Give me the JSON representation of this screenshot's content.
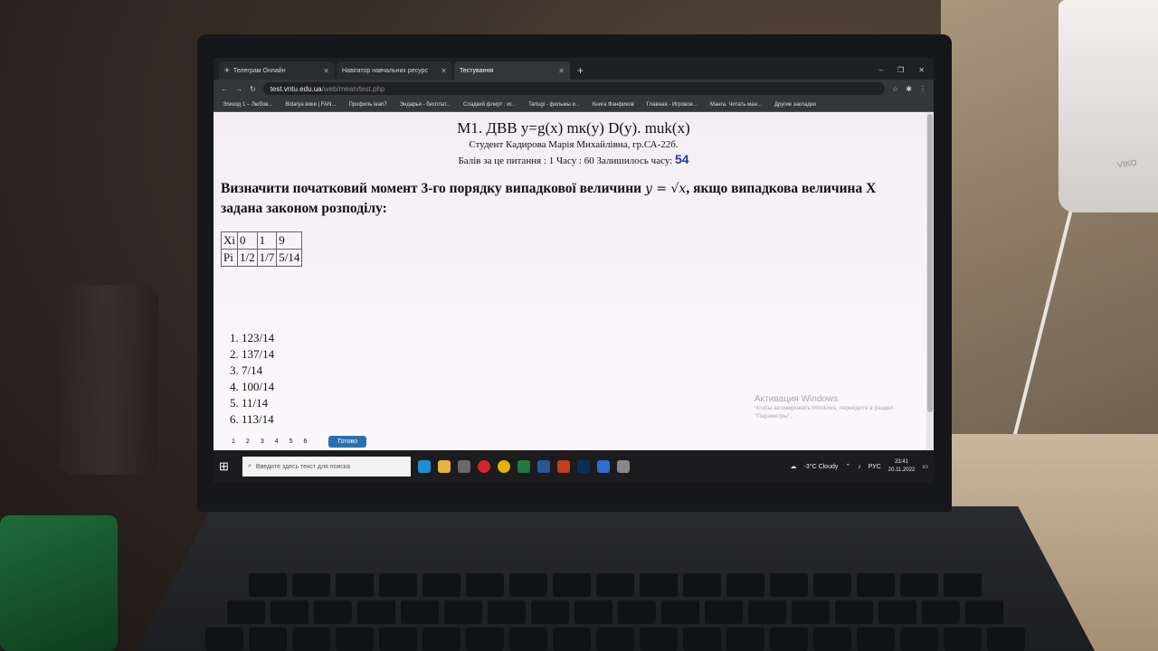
{
  "browser": {
    "tabs": [
      {
        "label": "Телеграм Онлайн"
      },
      {
        "label": "Навігатор навчальних ресурс"
      },
      {
        "label": "Тестування"
      }
    ],
    "url_host": "test.vntu.edu.ua",
    "url_path": "/web/mean/test.php",
    "bookmarks": [
      "Эпизод 1 – Любов...",
      "Bidarya вики | FAN...",
      "Профиль lean7",
      "Эндарья - бесплат...",
      "Сладкий флирт : иг...",
      "Tartugi - фильмы и...",
      "Книга Фанфиков",
      "Главная - Игровое...",
      "Манга. Читать ман...",
      "Другие закладки"
    ]
  },
  "test": {
    "title": "М1. ДВВ y=g(x) mк(y) D(y). muk(x)",
    "student": "Студент Кадирова Марія Михайлівна, гр.СА-22б.",
    "score_info": "Балів за це питання : 1 Часу : 60 Залишилось часу:",
    "time_left": "54",
    "question_pre": "Визначити початковий момент 3-го порядку випадкової величини",
    "question_formula": "y = √x",
    "question_post": ", якщо випадкова величина X задана законом розподілу:",
    "table": {
      "row_x_label": "Xi",
      "row_p_label": "Pi",
      "x_values": [
        "0",
        "1",
        "9"
      ],
      "p_values": [
        "1/2",
        "1/7",
        "5/14"
      ]
    },
    "answers": [
      "1. 123/14",
      "2. 137/14",
      "3. 7/14",
      "4. 100/14",
      "5. 11/14",
      "6. 113/14"
    ],
    "pager": [
      "1",
      "2",
      "3",
      "4",
      "5",
      "6"
    ],
    "done_label": "Готово"
  },
  "watermark": {
    "line1": "Активация Windows",
    "line2": "Чтобы активировать Windows, перейдите в раздел",
    "line3": "\"Параметры\"."
  },
  "taskbar": {
    "search_placeholder": "Введите здесь текст для поиска",
    "weather": "-3°C Cloudy",
    "lang": "РУС",
    "time": "23:41",
    "date": "20.11.2022"
  },
  "device": {
    "socket_brand": "VIKO"
  },
  "colors": {
    "timer": "#1b3aa8",
    "done_button": "#2a6fb0"
  }
}
